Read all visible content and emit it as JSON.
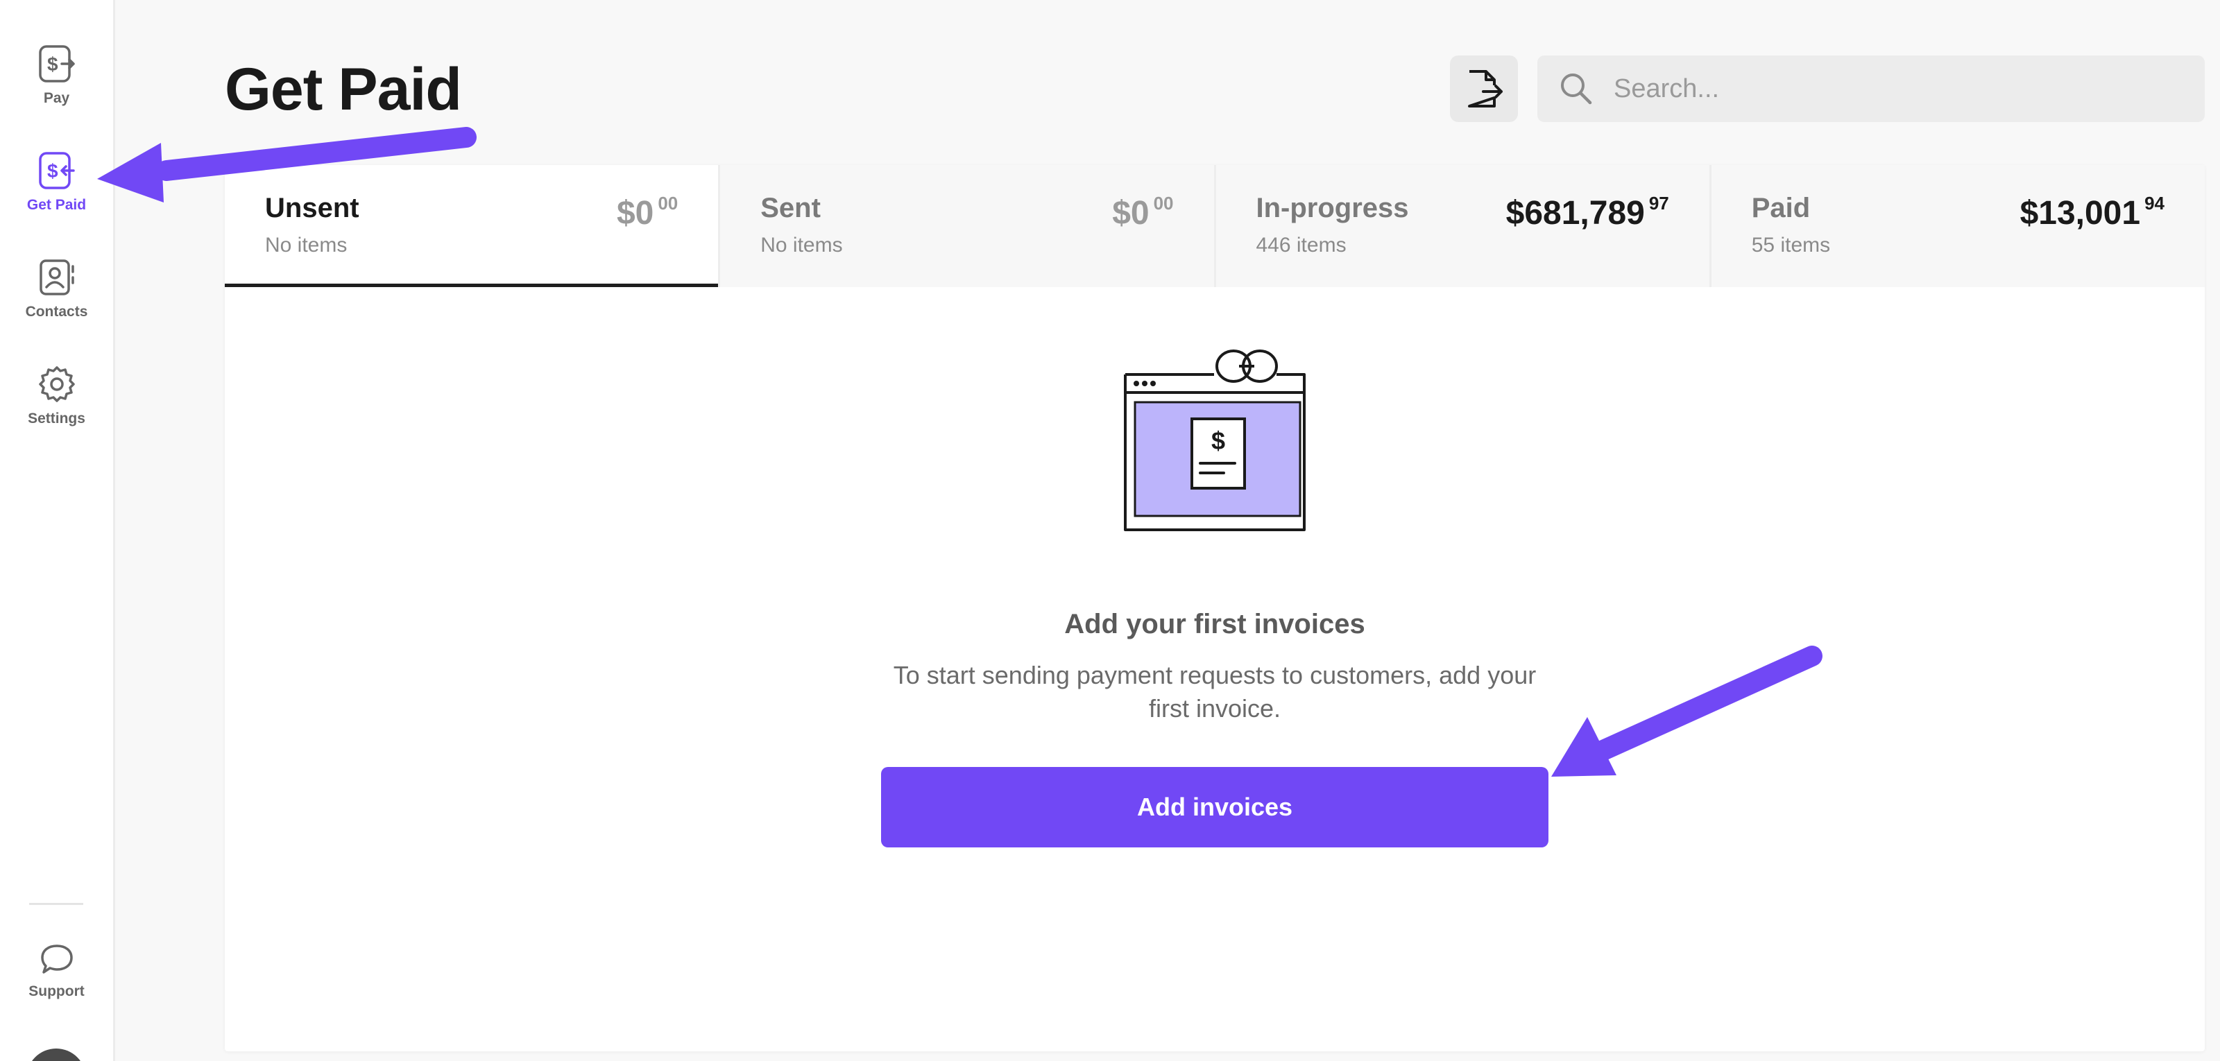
{
  "accent_color": "#7148f5",
  "illustration_color": "#bcb4fb",
  "sidebar": {
    "items": [
      {
        "label": "Pay",
        "icon": "dollar-out-icon",
        "active": false
      },
      {
        "label": "Get Paid",
        "icon": "dollar-in-icon",
        "active": true
      },
      {
        "label": "Contacts",
        "icon": "contacts-icon",
        "active": false
      },
      {
        "label": "Settings",
        "icon": "gear-icon",
        "active": false
      }
    ],
    "support": {
      "label": "Support",
      "icon": "chat-bubble-icon"
    }
  },
  "header": {
    "title": "Get Paid",
    "export_icon": "file-export-icon",
    "search": {
      "placeholder": "Search...",
      "value": "",
      "icon": "search-icon"
    }
  },
  "tabs": [
    {
      "name": "Unsent",
      "count": "No items",
      "amount": "$0",
      "cents": "00",
      "active": true
    },
    {
      "name": "Sent",
      "count": "No items",
      "amount": "$0",
      "cents": "00",
      "active": false
    },
    {
      "name": "In-progress",
      "count": "446 items",
      "amount": "$681,789",
      "cents": "97",
      "active": false
    },
    {
      "name": "Paid",
      "count": "55 items",
      "amount": "$13,001",
      "cents": "94",
      "active": false
    }
  ],
  "empty_state": {
    "illustration_icon": "invoice-browser-icon",
    "title": "Add your first invoices",
    "description": "To start sending payment requests to customers, add your first invoice.",
    "button_label": "Add invoices",
    "currency_symbol": "$"
  }
}
